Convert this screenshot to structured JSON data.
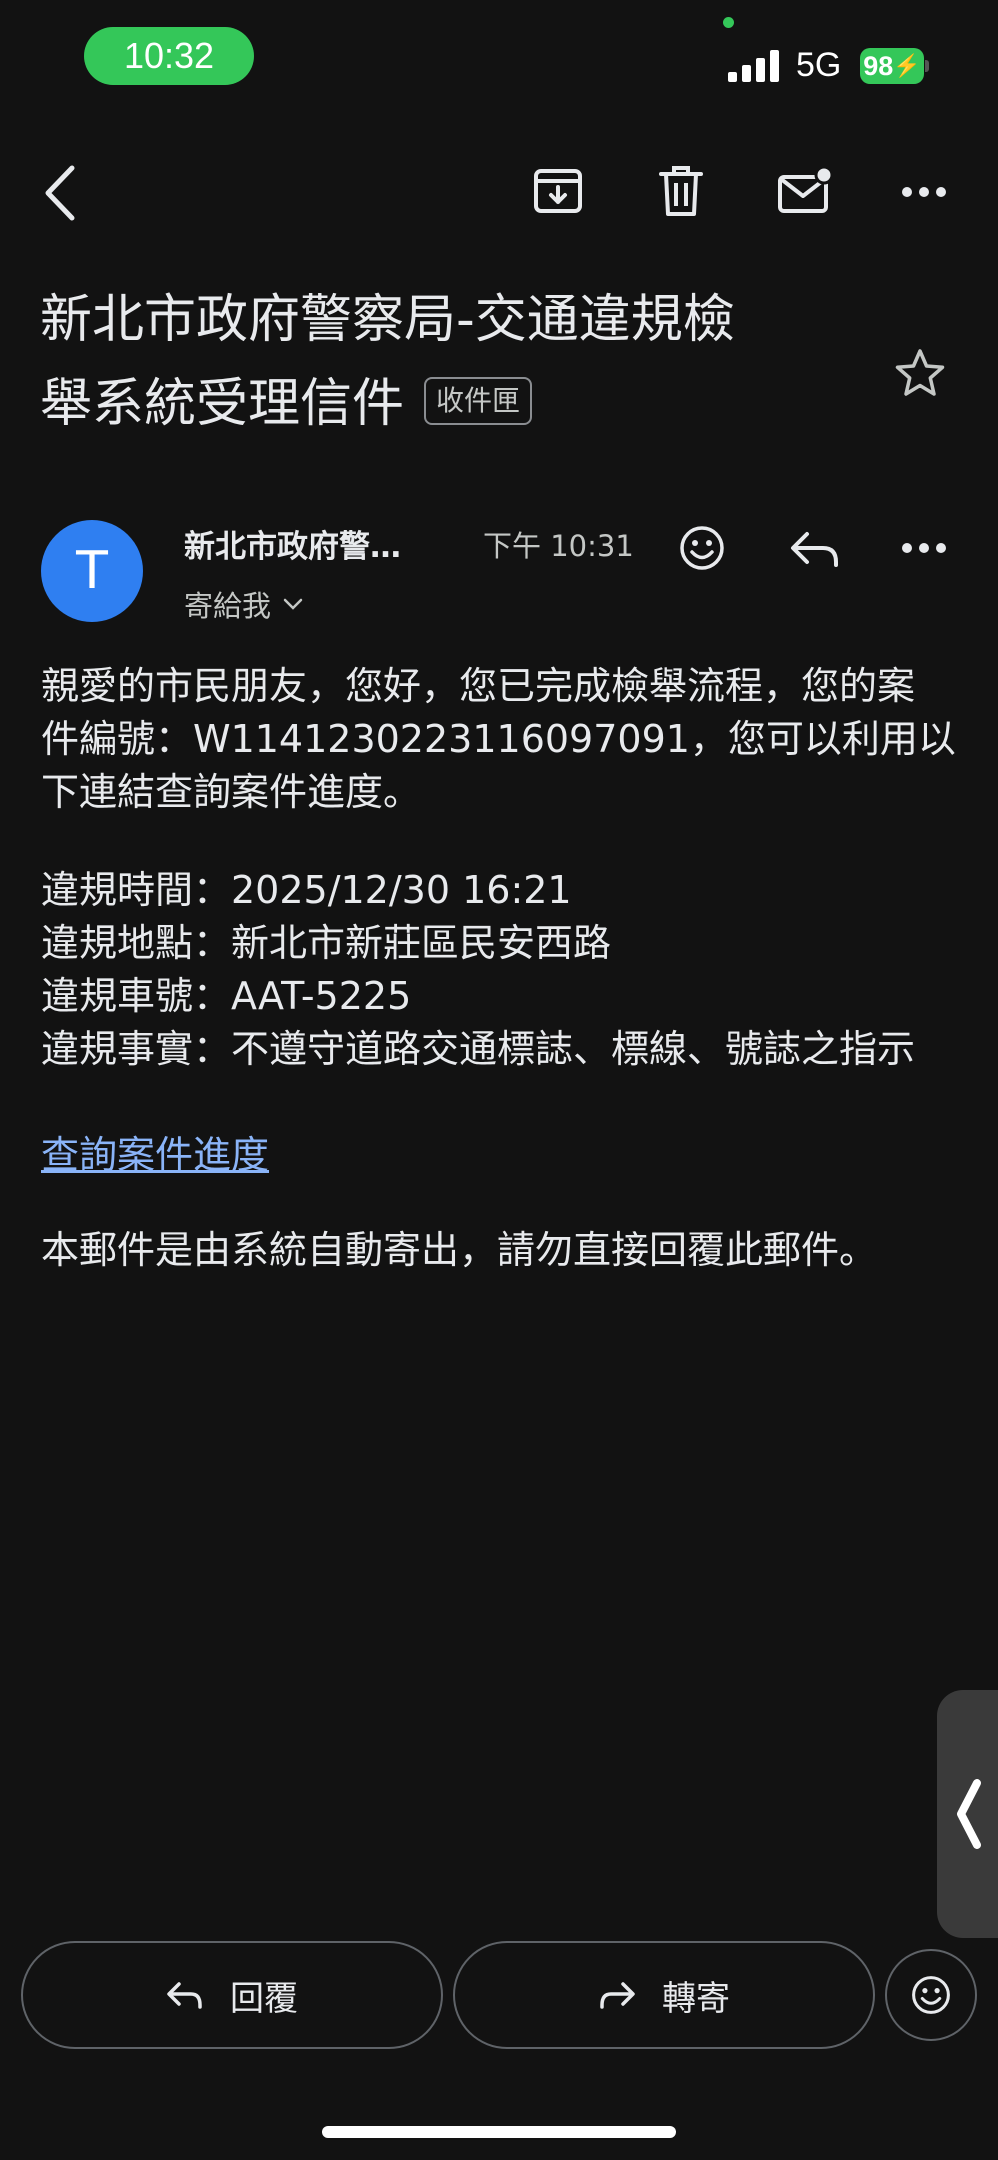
{
  "status_bar": {
    "time": "10:32",
    "network": "5G",
    "battery": "98"
  },
  "toolbar": {
    "icons": [
      "back-icon",
      "archive-icon",
      "delete-icon",
      "mark-unread-icon",
      "more-icon"
    ]
  },
  "email": {
    "subject_line1": "新北市政府警察局-交通違規檢",
    "subject_line2": "舉系統受理信件",
    "label": "收件匣",
    "sender_initial": "T",
    "sender": "新北市政府警…",
    "time": "下午 10:31",
    "recipient": "寄給我",
    "body": {
      "intro": [
        "親愛的市民朋友，您好，您已完成檢舉流程，您的案",
        "件編號：W1141230223116097091，您可以利用以",
        "下連結查詢案件進度。"
      ],
      "details": [
        "違規時間：2025/12/30 16:21",
        "違規地點：新北市新莊區民安西路",
        "違規車號：AAT-5225",
        "違規事實：不遵守道路交通標誌、標線、號誌之指示"
      ],
      "link": "查詢案件進度",
      "footer": "本郵件是由系統自動寄出，請勿直接回覆此郵件。"
    }
  },
  "actions": {
    "reply": "回覆",
    "forward": "轉寄"
  },
  "colors": {
    "background": "#121212",
    "accent_green": "#34c759",
    "avatar_blue": "#2f7ff1",
    "link": "#8ab4f8"
  }
}
